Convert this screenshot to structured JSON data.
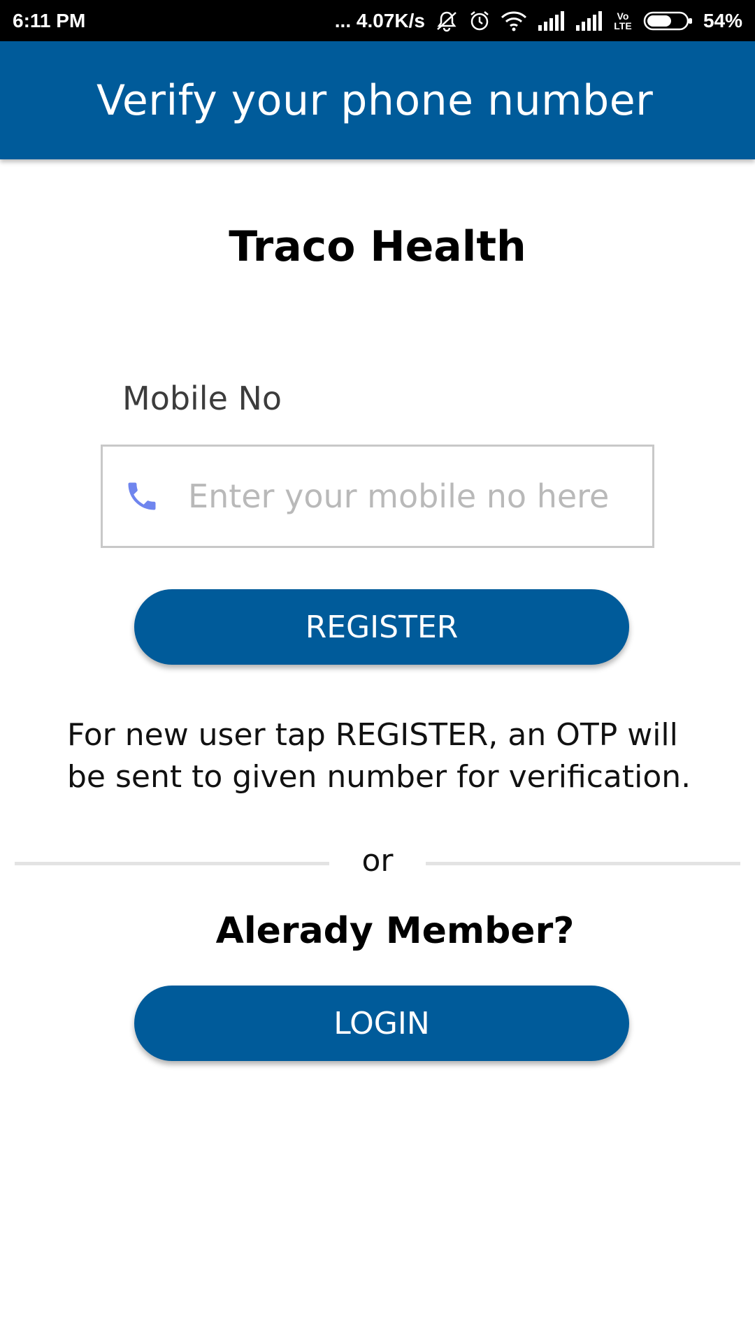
{
  "status_bar": {
    "time": "6:11 PM",
    "network_speed": "... 4.07K/s",
    "network_type": "Vo LTE",
    "battery": "54%",
    "icons": [
      "mute-icon",
      "alarm-icon",
      "wifi-icon",
      "signal-icon",
      "signal-icon",
      "volte-icon",
      "battery-icon"
    ]
  },
  "app_bar": {
    "title": "Verify your phone number",
    "color": "#005b9a"
  },
  "brand": {
    "name": "Traco Health"
  },
  "form": {
    "mobile_label": "Mobile No",
    "mobile_placeholder": "Enter your mobile no here",
    "mobile_value": "",
    "phone_icon": "phone-icon",
    "phone_icon_color": "#6f85ee"
  },
  "actions": {
    "register_label": "REGISTER",
    "info_text": "For new user tap REGISTER, an OTP will be sent to given number for verification.",
    "or_text": "or",
    "member_text": "Alerady Member?",
    "login_label": "LOGIN"
  }
}
